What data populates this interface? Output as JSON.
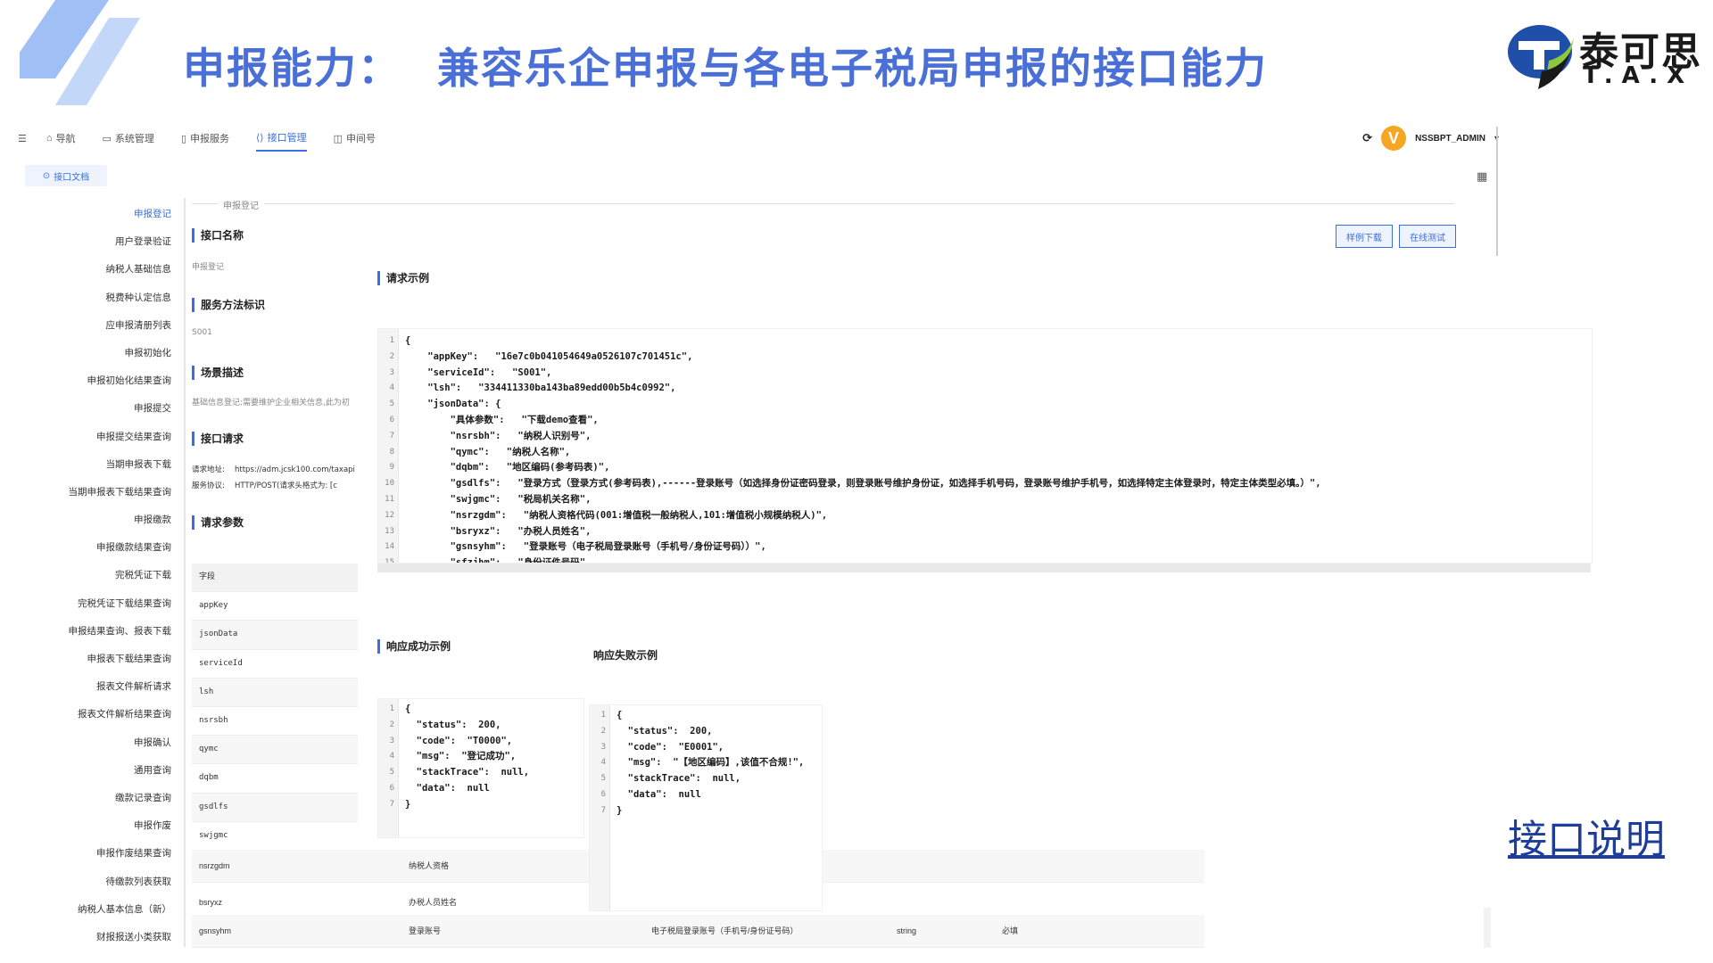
{
  "slide": {
    "title_part1": "申报能力：",
    "title_part2": "兼容乐企申报与各电子税局申报的接口能力",
    "logo_text": "泰可思",
    "logo_sub": "T.A.X",
    "bottom_link": "接口说明"
  },
  "nav": {
    "items": [
      {
        "label": "导航",
        "icon": "home-icon"
      },
      {
        "label": "系统管理",
        "icon": "monitor-icon"
      },
      {
        "label": "申报服务",
        "icon": "document-icon"
      },
      {
        "label": "接口管理",
        "icon": "code-icon"
      },
      {
        "label": "申间号",
        "icon": "window-icon"
      }
    ],
    "active": "接口管理",
    "avatar_letter": "V",
    "user": "NSSBPT_ADMIN",
    "accent": "#3b6fe0"
  },
  "doc_tab": "接口文档",
  "breadcrumb": "申报登记",
  "buttons": {
    "download": "样例下载",
    "online_test": "在线测试"
  },
  "sidebar": {
    "items": [
      "申报登记",
      "用户登录验证",
      "纳税人基础信息",
      "税费种认定信息",
      "应申报清册列表",
      "申报初始化",
      "申报初始化结果查询",
      "申报提交",
      "申报提交结果查询",
      "当期申报表下载",
      "当期申报表下载结果查询",
      "申报缴款",
      "申报缴款结果查询",
      "完税凭证下载",
      "完税凭证下载结果查询",
      "申报结果查询、报表下载",
      "申报表下载结果查询",
      "报表文件解析请求",
      "报表文件解析结果查询",
      "申报确认",
      "通用查询",
      "缴款记录查询",
      "申报作废",
      "申报作废结果查询",
      "待缴款列表获取",
      "纳税人基本信息（新）",
      "财报报送小类获取"
    ],
    "active_index": 0
  },
  "info": {
    "name_label": "接口名称",
    "name_value": "申报登记",
    "method_label": "服务方法标识",
    "method_value": "S001",
    "scene_label": "场景描述",
    "scene_value": "基础信息登记:需要维护企业相关信息,此为初",
    "request_label": "接口请求",
    "req_addr_k": "请求地址:",
    "req_addr_v": "https://adm.jcsk100.com/taxapi",
    "req_proto_k": "服务协议:",
    "req_proto_v": "HTTP/POST(请求头格式为: [c",
    "params_label": "请求参数"
  },
  "params": {
    "header": "字段",
    "fields": [
      "appKey",
      "jsonData",
      "serviceId",
      "lsh",
      "nsrsbh",
      "qymc",
      "dqbm",
      "gsdlfs",
      "swjgmc"
    ],
    "wide_rows": [
      {
        "field": "nsrzgdm",
        "name": "纳税人资格"
      },
      {
        "field": "bsryxz",
        "name": "办税人员姓名"
      },
      {
        "field": "gsnsyhm",
        "name": "登录账号",
        "desc": "电子税局登录账号（手机号/身份证号码）",
        "type": "string",
        "required": "必填"
      }
    ]
  },
  "request_example": {
    "title": "请求示例",
    "lines": [
      {
        "n": "1",
        "t": "{"
      },
      {
        "n": "2",
        "t": "    \"appKey\":   \"16e7c0b041054649a0526107c701451c\","
      },
      {
        "n": "3",
        "t": "    \"serviceId\":   \"S001\","
      },
      {
        "n": "4",
        "t": "    \"lsh\":   \"334411330ba143ba89edd00b5b4c0992\","
      },
      {
        "n": "5",
        "t": "    \"jsonData\": {"
      },
      {
        "n": "6",
        "t": "        \"具体参数\":   \"下载demo查看\","
      },
      {
        "n": "7",
        "t": "        \"nsrsbh\":   \"纳税人识别号\","
      },
      {
        "n": "8",
        "t": "        \"qymc\":   \"纳税人名称\","
      },
      {
        "n": "9",
        "t": "        \"dqbm\":   \"地区编码(参考码表)\","
      },
      {
        "n": "10",
        "t": "        \"gsdlfs\":   \"登录方式（登录方式(参考码表),------登录账号（如选择身份证密码登录，则登录账号维护身份证，如选择手机号码，登录账号维护手机号，如选择特定主体登录时，特定主体类型必填。）\","
      },
      {
        "n": "11",
        "t": "        \"swjgmc\":   \"税局机关名称\","
      },
      {
        "n": "12",
        "t": "        \"nsrzgdm\":   \"纳税人资格代码(001:增值税一般纳税人,101:增值税小规模纳税人)\","
      },
      {
        "n": "13",
        "t": "        \"bsryxz\":   \"办税人员姓名\","
      },
      {
        "n": "14",
        "t": "        \"gsnsyhm\":   \"登录账号（电子税局登录账号（手机号/身份证号码））\","
      },
      {
        "n": "15",
        "t": "        \"sfzjhm\":   \"身份证件号码\","
      }
    ]
  },
  "success_example": {
    "title": "响应成功示例",
    "lines": [
      {
        "n": "1",
        "t": "{"
      },
      {
        "n": "2",
        "t": "  \"status\":  200,"
      },
      {
        "n": "3",
        "t": "  \"code\":  \"T0000\","
      },
      {
        "n": "4",
        "t": "  \"msg\":  \"登记成功\","
      },
      {
        "n": "5",
        "t": "  \"stackTrace\":  null,"
      },
      {
        "n": "6",
        "t": "  \"data\":  null"
      },
      {
        "n": "7",
        "t": "}"
      }
    ]
  },
  "fail_example": {
    "title": "响应失败示例",
    "lines": [
      {
        "n": "1",
        "t": "{"
      },
      {
        "n": "2",
        "t": "  \"status\":  200,"
      },
      {
        "n": "3",
        "t": "  \"code\":  \"E0001\","
      },
      {
        "n": "4",
        "t": "  \"msg\":  \"【地区编码】,该值不合规!\","
      },
      {
        "n": "5",
        "t": "  \"stackTrace\":  null,"
      },
      {
        "n": "6",
        "t": "  \"data\":  null"
      },
      {
        "n": "7",
        "t": "}"
      }
    ]
  }
}
